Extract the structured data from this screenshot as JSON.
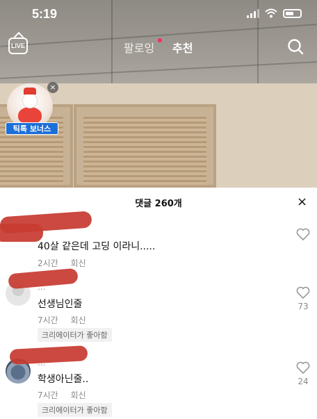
{
  "status_bar": {
    "time": "5:19"
  },
  "nav": {
    "live_label": "LIVE",
    "tabs": [
      {
        "label": "팔로잉"
      },
      {
        "label": "추천"
      }
    ]
  },
  "bonus": {
    "label": "틱톡 보너스"
  },
  "comments_sheet": {
    "title": "댓글 260개",
    "close_glyph": "×",
    "items": [
      {
        "text": "40살 같은데   고딩 이라니.....",
        "time": "2시간",
        "reply": "회신"
      },
      {
        "username": "...",
        "text": "선생님인줄",
        "time": "7시간",
        "reply": "회신",
        "creator_liked": "크리에이터가 좋아함",
        "likes": "73"
      },
      {
        "username": "...",
        "text": "학생아닌줄..",
        "time": "7시간",
        "reply": "회신",
        "creator_liked": "크리에이터가 좋아함",
        "likes": "24"
      }
    ]
  },
  "colors": {
    "redaction": "#c73b32",
    "badge_blue": "#1d6fd8",
    "notification_red": "#ff2b54"
  }
}
